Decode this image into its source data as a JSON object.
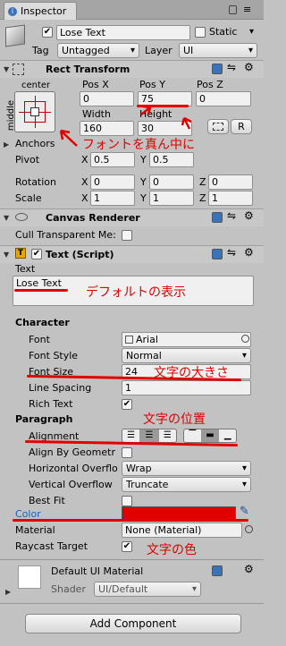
{
  "tab": {
    "title": "Inspector"
  },
  "header": {
    "object_name": "Lose Text",
    "static_label": "Static",
    "tag_label": "Tag",
    "tag_value": "Untagged",
    "layer_label": "Layer",
    "layer_value": "UI"
  },
  "rect_transform": {
    "title": "Rect Transform",
    "anchor_h": "center",
    "anchor_v": "middle",
    "pos_x_label": "Pos X",
    "pos_y_label": "Pos Y",
    "pos_z_label": "Pos Z",
    "pos_x": "0",
    "pos_y": "75",
    "pos_z": "0",
    "width_label": "Width",
    "height_label": "Height",
    "width": "160",
    "height": "30",
    "raw_btn": "R",
    "anchors_label": "Anchors",
    "pivot_label": "Pivot",
    "pivot_x": "0.5",
    "pivot_y": "0.5",
    "rotation_label": "Rotation",
    "rot_x": "0",
    "rot_y": "0",
    "rot_z": "0",
    "scale_label": "Scale",
    "scale_x": "1",
    "scale_y": "1",
    "scale_z": "1",
    "axis_x": "X",
    "axis_y": "Y",
    "axis_z": "Z"
  },
  "canvas_renderer": {
    "title": "Canvas Renderer",
    "cull_label": "Cull Transparent Me:"
  },
  "text_script": {
    "title": "Text (Script)",
    "text_label": "Text",
    "text_value": "Lose Text",
    "character_label": "Character",
    "font_label": "Font",
    "font_value": "Arial",
    "font_style_label": "Font Style",
    "font_style_value": "Normal",
    "font_size_label": "Font Size",
    "font_size_value": "24",
    "line_spacing_label": "Line Spacing",
    "line_spacing_value": "1",
    "rich_text_label": "Rich Text",
    "paragraph_label": "Paragraph",
    "alignment_label": "Alignment",
    "align_by_geometry_label": "Align By Geometr",
    "horizontal_overflow_label": "Horizontal Overflo",
    "horizontal_overflow_value": "Wrap",
    "vertical_overflow_label": "Vertical Overflow",
    "vertical_overflow_value": "Truncate",
    "best_fit_label": "Best Fit",
    "color_label": "Color",
    "color_value": "#e00000",
    "material_label": "Material",
    "material_value": "None (Material)",
    "raycast_label": "Raycast Target"
  },
  "material_section": {
    "title": "Default UI Material",
    "shader_label": "Shader",
    "shader_value": "UI/Default"
  },
  "add_component": "Add Component",
  "annotations": {
    "center_font": "フォントを真ん中に",
    "default_display": "デフォルトの表示",
    "font_size_note": "文字の大きさ",
    "position_note": "文字の位置",
    "color_note": "文字の色"
  },
  "colors": {
    "accent": "#e00000",
    "color_label": "#1a5bc4"
  }
}
